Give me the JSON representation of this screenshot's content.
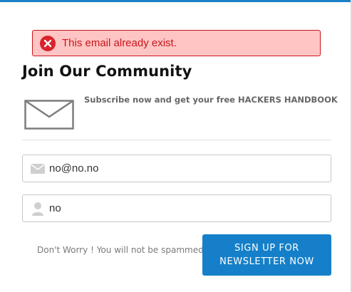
{
  "alert": {
    "message": "This email already exist.",
    "icon": "error-circle-icon",
    "color": "#c9161b",
    "background": "#ffc4c4"
  },
  "form": {
    "title": "Join Our Community",
    "subscribe_text": "Subscribe now and get your free HACKERS HANDBOOK",
    "email_icon": "envelope-icon",
    "email_value": "no@no.no",
    "name_icon": "user-icon",
    "name_value": "no",
    "spam_note": "Don't Worry ! You will not be spammed",
    "submit_line1": "SIGN UP FOR",
    "submit_line2": "NEWSLETTER NOW",
    "accent_color": "#1580c9"
  }
}
